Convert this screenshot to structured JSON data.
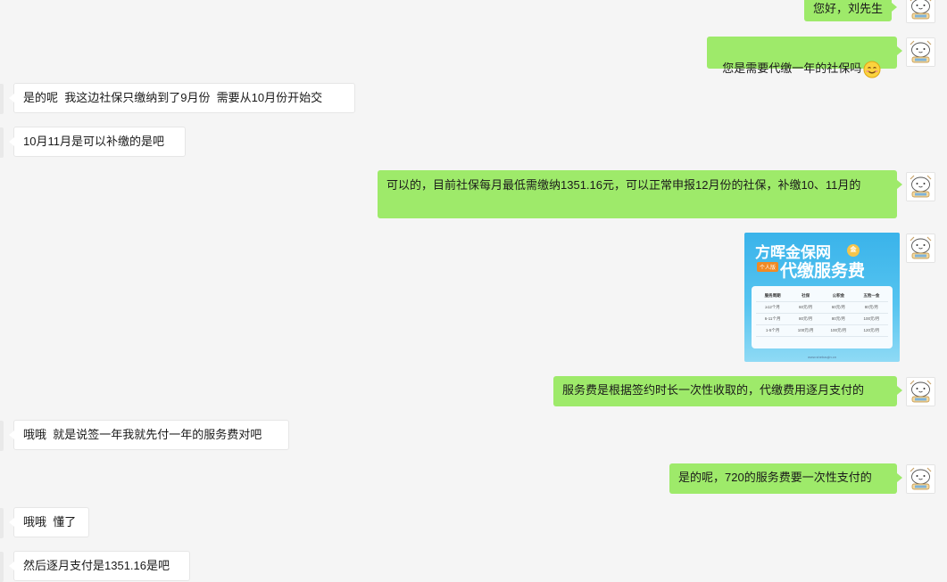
{
  "colors": {
    "background": "#f5f5f5",
    "self_bubble": "#9eea6a",
    "other_bubble": "#ffffff"
  },
  "messages": [
    {
      "id": "m1",
      "side": "right",
      "text": "您好，刘先生"
    },
    {
      "id": "m2",
      "side": "right",
      "text": "您是需要代缴一年的社保吗",
      "emoji": "smile-emoji"
    },
    {
      "id": "m3",
      "side": "left",
      "text": "是的呢  我这边社保只缴纳到了9月份  需要从10月份开始交"
    },
    {
      "id": "m4",
      "side": "left",
      "text": "10月11月是可以补缴的是吧"
    },
    {
      "id": "m5",
      "side": "right",
      "text": "可以的，目前社保每月最低需缴纳1351.16元，可以正常申报12月份的社保，补缴10、11月的"
    },
    {
      "id": "m6",
      "side": "right",
      "type": "image"
    },
    {
      "id": "m7",
      "side": "right",
      "text": "服务费是根据签约时长一次性收取的，代缴费用逐月支付的"
    },
    {
      "id": "m8",
      "side": "left",
      "text": "哦哦  就是说签一年我就先付一年的服务费对吧"
    },
    {
      "id": "m9",
      "side": "right",
      "text": "是的呢，720的服务费要一次性支付的"
    },
    {
      "id": "m10",
      "side": "left",
      "text": "哦哦  懂了"
    },
    {
      "id": "m11",
      "side": "left",
      "text": "然后逐月支付是1351.16是吧"
    }
  ],
  "image_card": {
    "title": "方晖金保网",
    "subtitle": "代缴服务费",
    "tag": "个人版",
    "coin": "金",
    "table": {
      "headers": [
        "服务周期",
        "社保",
        "公积金",
        "五险一金"
      ],
      "rows": [
        [
          "≥12个月",
          "60元/月",
          "60元/月",
          "80元/月"
        ],
        [
          "6-11个月",
          "80元/月",
          "80元/月",
          "100元/月"
        ],
        [
          "1-5个月",
          "100元/月",
          "100元/月",
          "120元/月"
        ]
      ]
    },
    "url": "www.shebaojin.cn"
  },
  "avatar_icon": "cartoon-cat-avatar-icon"
}
